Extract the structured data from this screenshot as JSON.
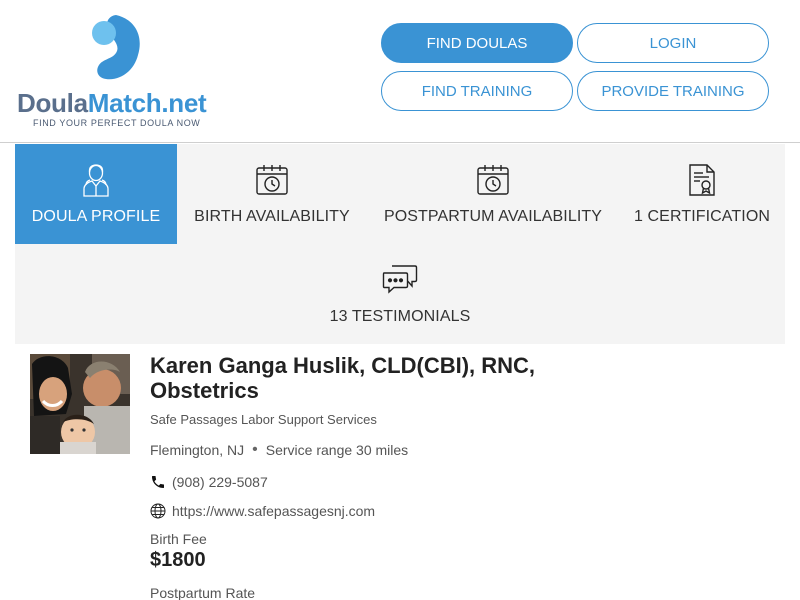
{
  "brand": {
    "name_part1": "Doula",
    "name_part2": "Match.net",
    "tagline": "FIND YOUR PERFECT DOULA NOW",
    "colors": {
      "primary": "#3a93d4",
      "light": "#6ec1ee",
      "text": "#5a6f8c"
    }
  },
  "nav": {
    "find_doulas": "FIND DOULAS",
    "login": "LOGIN",
    "find_training": "FIND TRAINING",
    "provide_training": "PROVIDE TRAINING"
  },
  "tabs": [
    {
      "label": "DOULA PROFILE",
      "icon": "person-icon",
      "active": true
    },
    {
      "label": "BIRTH AVAILABILITY",
      "icon": "calendar-clock-icon",
      "active": false
    },
    {
      "label": "POSTPARTUM AVAILABILITY",
      "icon": "calendar-clock-icon",
      "active": false
    },
    {
      "label": "1 CERTIFICATION",
      "icon": "certificate-icon",
      "active": false
    },
    {
      "label": "13 TESTIMONIALS",
      "icon": "chat-bubbles-icon",
      "active": false
    }
  ],
  "profile": {
    "name": "Karen Ganga Huslik, CLD(CBI), RNC, Obstetrics",
    "organization": "Safe Passages Labor Support Services",
    "location": "Flemington, NJ",
    "service_range": "Service range 30 miles",
    "phone": "(908) 229-5087",
    "website": "https://www.safepassagesnj.com",
    "birth_fee_label": "Birth Fee",
    "birth_fee": "$1800",
    "postpartum_rate_label": "Postpartum Rate"
  }
}
